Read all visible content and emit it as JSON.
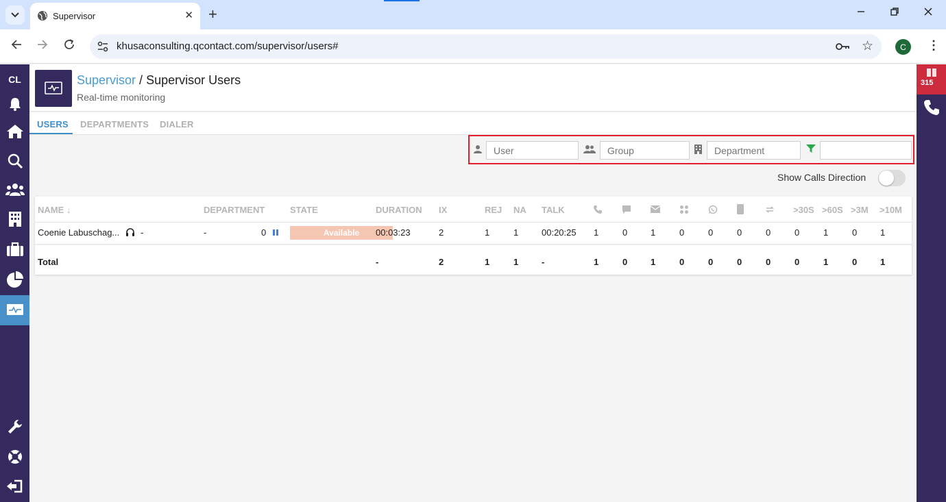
{
  "browser": {
    "tab_title": "Supervisor",
    "url": "khusaconsulting.qcontact.com/supervisor/users#",
    "profile_initial": "C"
  },
  "sidebar": {
    "brand": "CL"
  },
  "rightbar": {
    "badge_count": "315"
  },
  "header": {
    "breadcrumb_root": "Supervisor",
    "breadcrumb_sep": " / ",
    "breadcrumb_current": "Supervisor Users",
    "subtitle": "Real-time monitoring"
  },
  "tabs": [
    {
      "label": "USERS",
      "active": true
    },
    {
      "label": "DEPARTMENTS",
      "active": false
    },
    {
      "label": "DIALER",
      "active": false
    }
  ],
  "filters": {
    "user_placeholder": "User",
    "group_placeholder": "Group",
    "department_placeholder": "Department",
    "text_value": ""
  },
  "toggle": {
    "label": "Show Calls Direction",
    "on": false
  },
  "table": {
    "headers": {
      "name": "NAME ↓",
      "department": "DEPARTMENT",
      "state": "STATE",
      "duration": "DURATION",
      "ix": "IX",
      "rej": "REJ",
      "na": "NA",
      "talk": "TALK",
      "gt30s": ">30S",
      "gt60s": ">60S",
      "gt3m": ">3M",
      "gt10m": ">10M"
    },
    "row": {
      "name": "Coenie Labuschag...",
      "extension": "-",
      "department": "-",
      "queue_count": "0",
      "state": "Available",
      "duration": "00:03:23",
      "ix": "2",
      "rej": "1",
      "na": "1",
      "talk": "00:20:25",
      "calls": "1",
      "chat": "0",
      "email": "1",
      "social": "0",
      "whatsapp": "0",
      "sms": "0",
      "transfer": "0",
      "gt30s": "0",
      "gt60s": "1",
      "gt3m": "0",
      "gt10m": "1"
    },
    "total": {
      "label": "Total",
      "duration": "-",
      "ix": "2",
      "rej": "1",
      "na": "1",
      "talk": "-",
      "calls": "1",
      "chat": "0",
      "email": "1",
      "social": "0",
      "whatsapp": "0",
      "sms": "0",
      "transfer": "0",
      "gt30s": "0",
      "gt60s": "1",
      "gt3m": "0",
      "gt10m": "1"
    }
  },
  "colors": {
    "sidebar": "#352a5e",
    "accent": "#3f8ec8",
    "state_available": "#f5c6b2",
    "badge": "#cc2c3e",
    "highlight": "#e0202c"
  }
}
